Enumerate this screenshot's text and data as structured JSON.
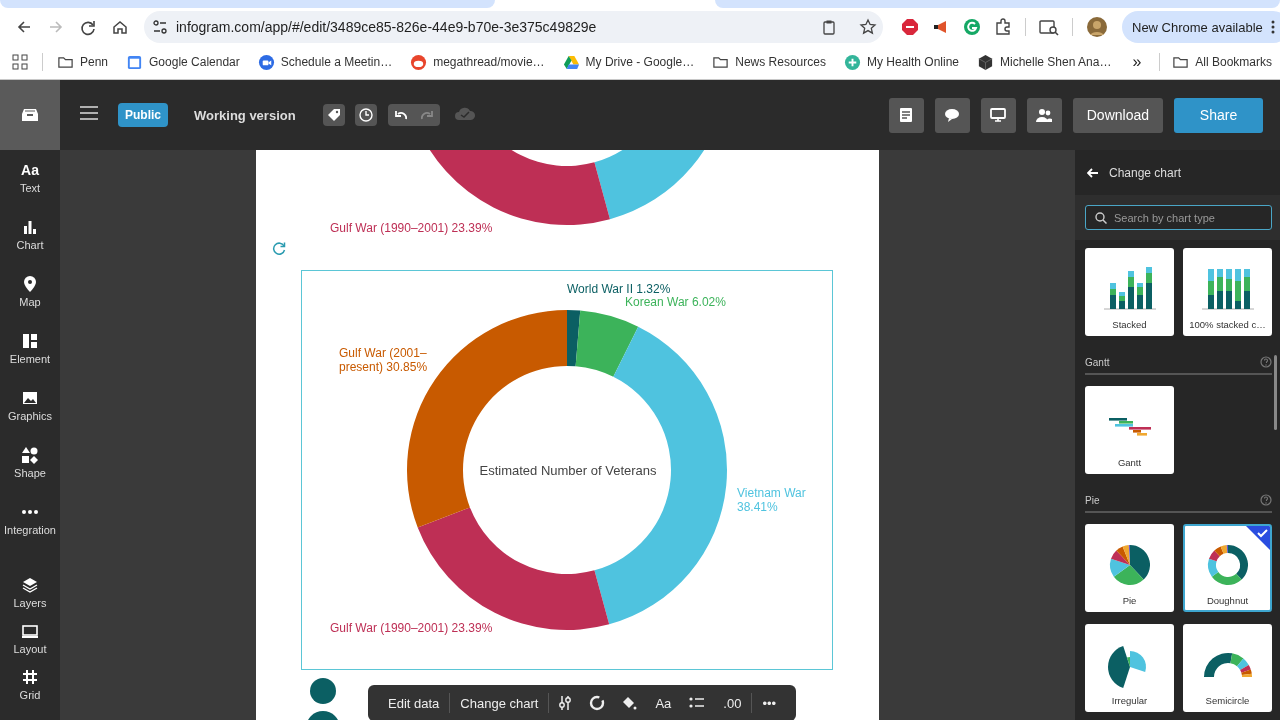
{
  "browser": {
    "url": "infogram.com/app/#/edit/3489ce85-826e-44e9-b70e-3e375c49829e",
    "update_button": "New Chrome available",
    "bookmarks": [
      {
        "label": "Penn",
        "kind": "folder"
      },
      {
        "label": "Google Calendar",
        "kind": "calendar"
      },
      {
        "label": "Schedule a Meetin…",
        "kind": "video"
      },
      {
        "label": "megathread/movie…",
        "kind": "alien"
      },
      {
        "label": "My Drive - Google…",
        "kind": "drive"
      },
      {
        "label": "News Resources",
        "kind": "folder"
      },
      {
        "label": "My Health Online",
        "kind": "health"
      },
      {
        "label": "Michelle Shen Ana…",
        "kind": "cube"
      }
    ],
    "overflow": "»",
    "all_bookmarks": "All Bookmarks"
  },
  "editor": {
    "visibility": "Public",
    "version": "Working version",
    "download": "Download",
    "share": "Share"
  },
  "rail": {
    "items": [
      {
        "label": "Text",
        "kind": "text",
        "glyph": "Aa"
      },
      {
        "label": "Chart",
        "kind": "chart"
      },
      {
        "label": "Map",
        "kind": "map"
      },
      {
        "label": "Element",
        "kind": "element"
      },
      {
        "label": "Graphics",
        "kind": "graphics"
      },
      {
        "label": "Shape",
        "kind": "shape"
      },
      {
        "label": "Integration",
        "kind": "integration"
      }
    ],
    "bottom_items": [
      {
        "label": "Layers",
        "kind": "layers"
      },
      {
        "label": "Layout",
        "kind": "layout"
      },
      {
        "label": "Grid",
        "kind": "grid"
      }
    ]
  },
  "page": {
    "upper_chart": {
      "label": "Gulf War (1990–2001) 23.39%"
    },
    "chart_data": {
      "type": "donut",
      "title": "Estimated Number of Veterans",
      "categories": [
        "World War II",
        "Korean War",
        "Vietnam War",
        "Gulf War (1990–2001)",
        "Gulf War (2001–present)"
      ],
      "colors": [
        "#0b5f63",
        "#3cb35a",
        "#4fc3df",
        "#be2f55",
        "#c85a00"
      ],
      "values": [
        1.32,
        6.02,
        38.41,
        23.39,
        30.85
      ],
      "value_labels": [
        "1.32%",
        "6.02%",
        "38.41%",
        "23.39%",
        "30.85%"
      ]
    }
  },
  "toolbar": {
    "edit": "Edit data",
    "change": "Change chart",
    "font_glyph": "Aa",
    "decimals": ".00",
    "more": "•••"
  },
  "panel": {
    "title": "Change chart",
    "search": {
      "placeholder": "Search by chart type"
    },
    "sections": [
      {
        "cards": [
          {
            "label": "Stacked",
            "kind": "stacked",
            "selected": false
          },
          {
            "label": "100% stacked c…",
            "kind": "stacked100",
            "selected": false
          }
        ]
      },
      {
        "title": "Gantt",
        "cards": [
          {
            "label": "Gantt",
            "kind": "gantt",
            "selected": false
          }
        ]
      },
      {
        "title": "Pie",
        "cards": [
          {
            "label": "Pie",
            "kind": "pie",
            "selected": false
          },
          {
            "label": "Doughnut",
            "kind": "doughnut",
            "selected": true
          },
          {
            "label": "Irregular",
            "kind": "irregular",
            "selected": false
          },
          {
            "label": "Semicircle",
            "kind": "semicircle",
            "selected": false
          }
        ]
      }
    ]
  }
}
